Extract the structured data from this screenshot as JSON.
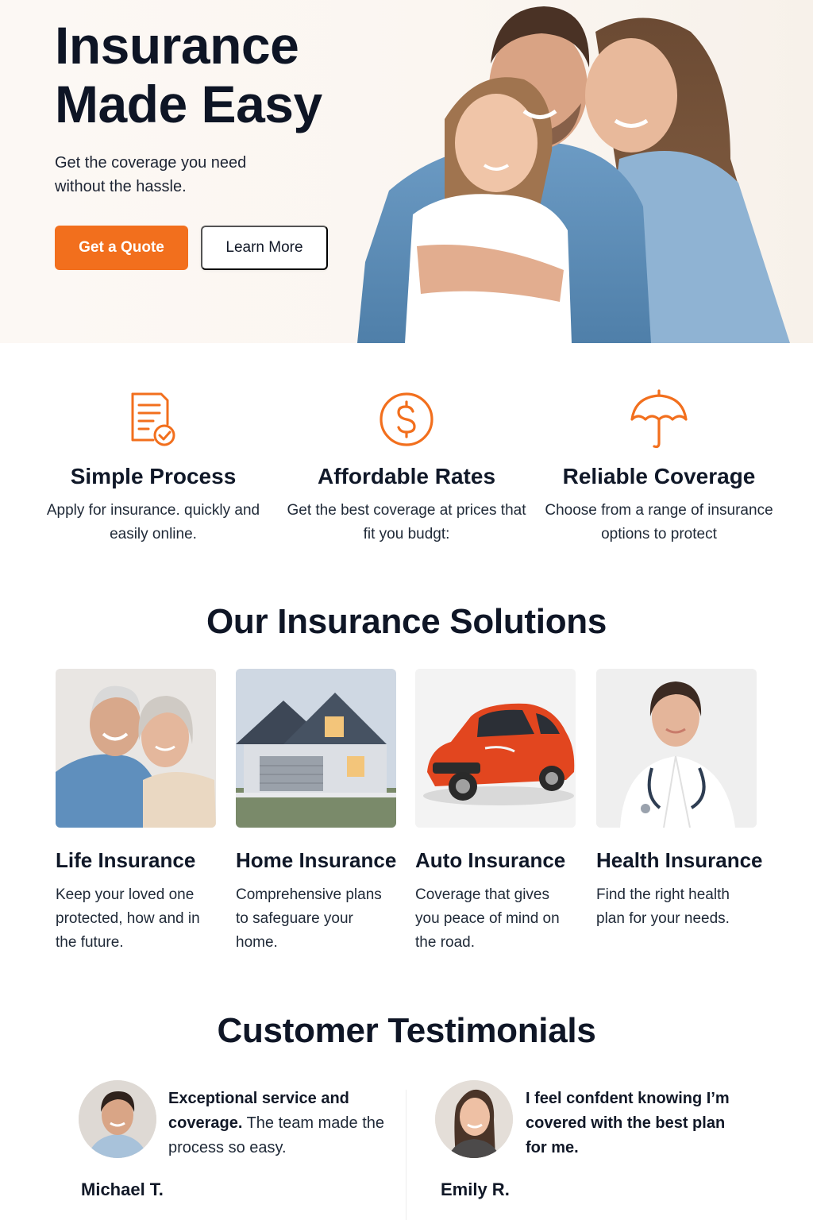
{
  "hero": {
    "title": "Insurance Made Easy",
    "subtitle": "Get the coverage you need without the hassle.",
    "primary_button": "Get a Quote",
    "secondary_button": "Learn More"
  },
  "features": [
    {
      "icon": "document-check-icon",
      "title": "Simple Process",
      "text": "Apply for insurance. quickly and easily online."
    },
    {
      "icon": "dollar-circle-icon",
      "title": "Affordable Rates",
      "text": "Get the best coverage at prices that fit you budgt:"
    },
    {
      "icon": "umbrella-icon",
      "title": "Reliable Coverage",
      "text": "Choose from a range of insurance options to protect"
    }
  ],
  "solutions": {
    "title": "Our Insurance Solutions",
    "items": [
      {
        "title": "Life Insurance",
        "text": "Keep your loved one protected, how and in the future."
      },
      {
        "title": "Home Insurance",
        "text": "Comprehensive plans to safeguare your home."
      },
      {
        "title": "Auto Insurance",
        "text": "Coverage that gives you peace of mind on the road."
      },
      {
        "title": "Health Insurance",
        "text": "Find the right health plan for your needs."
      }
    ]
  },
  "testimonials": {
    "title": "Customer Testimonials",
    "items": [
      {
        "quote_bold": "Exceptional service and coverage.",
        "quote_rest": " The team made the process so easy.",
        "author": "Michael T."
      },
      {
        "quote_bold": "I feel confdent knowing I’m covered with the best plan for me.",
        "quote_rest": "",
        "author": "Emily R."
      }
    ]
  },
  "colors": {
    "accent": "#f26f1d",
    "heading": "#0f1626",
    "hero_bg": "#fbf6f1"
  }
}
